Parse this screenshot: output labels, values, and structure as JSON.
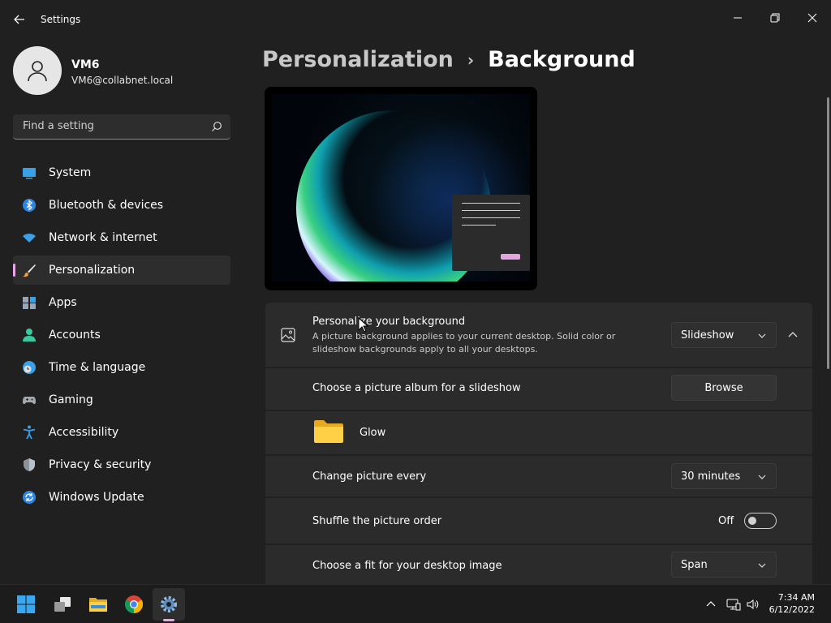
{
  "window": {
    "title": "Settings"
  },
  "user": {
    "name": "VM6",
    "email": "VM6@collabnet.local"
  },
  "search": {
    "placeholder": "Find a setting"
  },
  "nav": [
    {
      "label": "System",
      "icon": "monitor-icon"
    },
    {
      "label": "Bluetooth & devices",
      "icon": "bluetooth-icon"
    },
    {
      "label": "Network & internet",
      "icon": "wifi-icon"
    },
    {
      "label": "Personalization",
      "icon": "brush-icon",
      "active": true
    },
    {
      "label": "Apps",
      "icon": "apps-icon"
    },
    {
      "label": "Accounts",
      "icon": "person-icon"
    },
    {
      "label": "Time & language",
      "icon": "clock-globe-icon"
    },
    {
      "label": "Gaming",
      "icon": "gamepad-icon"
    },
    {
      "label": "Accessibility",
      "icon": "accessibility-icon"
    },
    {
      "label": "Privacy & security",
      "icon": "shield-icon"
    },
    {
      "label": "Windows Update",
      "icon": "update-icon"
    }
  ],
  "breadcrumb": {
    "parent": "Personalization",
    "separator": "›",
    "current": "Background"
  },
  "settings": {
    "personalize": {
      "title": "Personalize your background",
      "desc_line1": "A picture background applies to your current desktop. Solid color or",
      "desc_line2": "slideshow backgrounds apply to all your desktops.",
      "value": "Slideshow"
    },
    "album": {
      "title": "Choose a picture album for a slideshow",
      "button": "Browse"
    },
    "folder": {
      "name": "Glow"
    },
    "interval": {
      "title": "Change picture every",
      "value": "30 minutes"
    },
    "shuffle": {
      "title": "Shuffle the picture order",
      "state": "Off"
    },
    "fit": {
      "title": "Choose a fit for your desktop image",
      "value": "Span"
    }
  },
  "taskbar": {
    "time": "7:34 AM",
    "date": "6/12/2022"
  },
  "colors": {
    "accent": "#e9a6e9",
    "bg": "#202020",
    "card": "#2b2b2b"
  }
}
